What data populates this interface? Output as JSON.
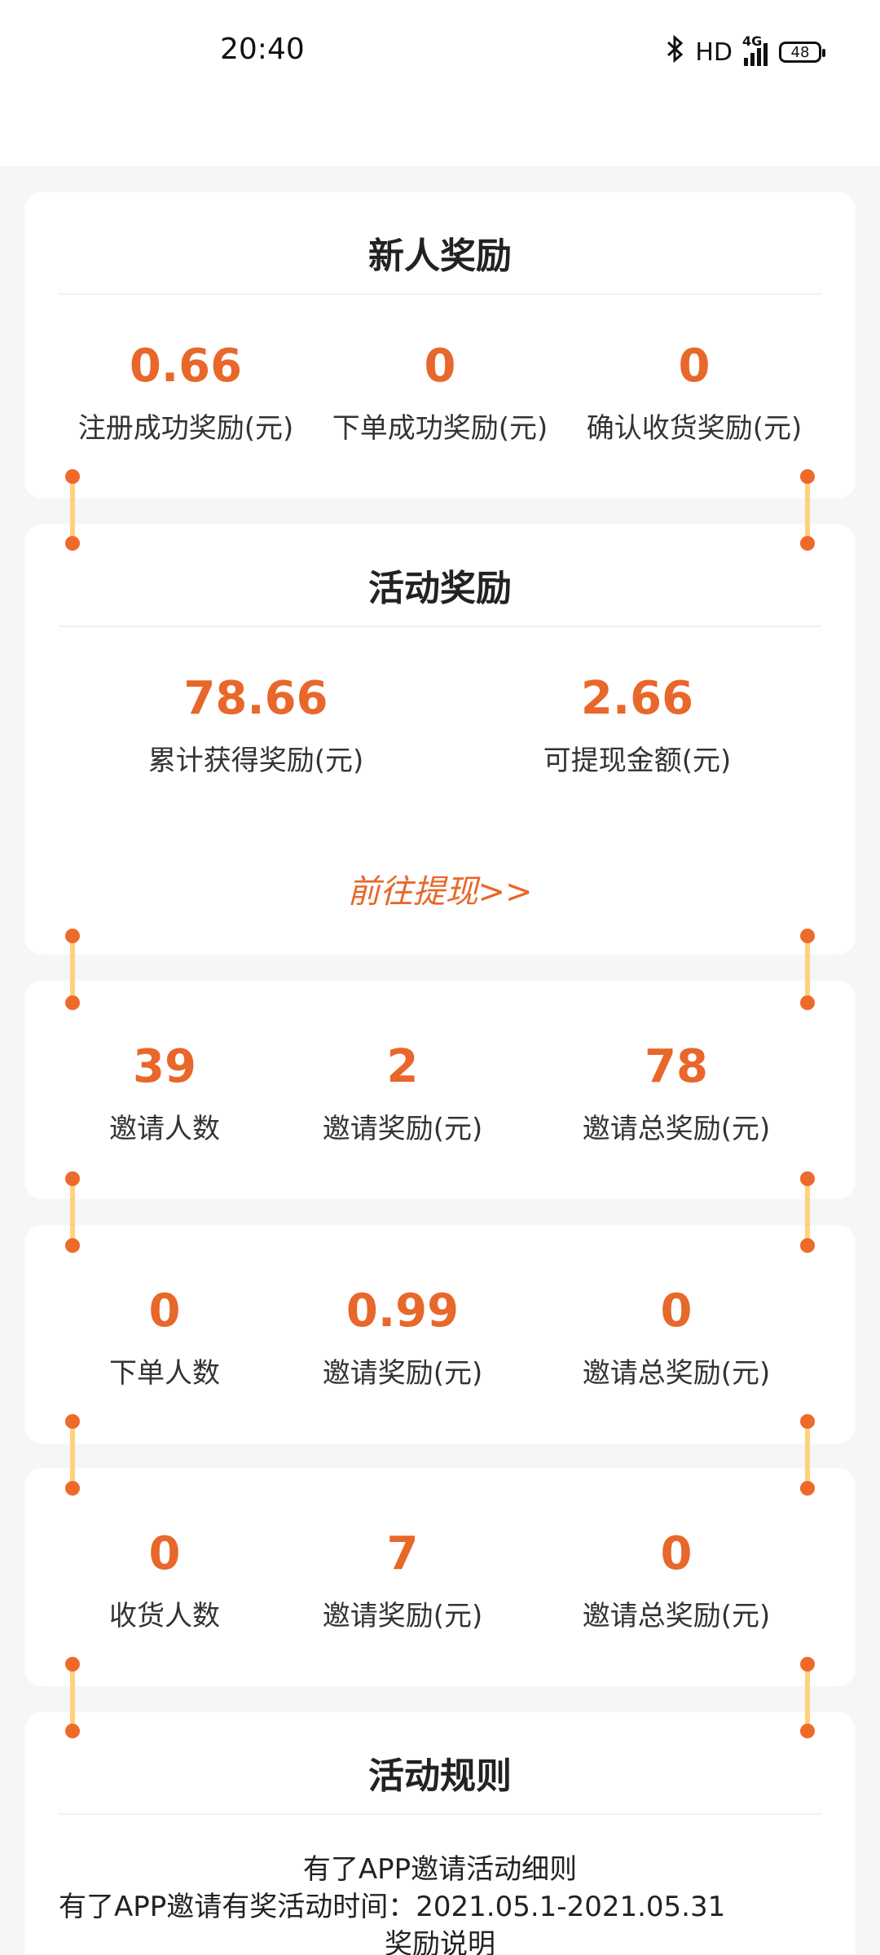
{
  "status_bar": {
    "time": "20:40",
    "network": "HD",
    "signal": "4G",
    "battery": "48"
  },
  "new_user_reward": {
    "title": "新人奖励",
    "stats": [
      {
        "value": "0.66",
        "label": "注册成功奖励(元)"
      },
      {
        "value": "0",
        "label": "下单成功奖励(元)"
      },
      {
        "value": "0",
        "label": "确认收货奖励(元)"
      }
    ]
  },
  "activity_reward": {
    "title": "活动奖励",
    "stats": [
      {
        "value": "78.66",
        "label": "累计获得奖励(元)"
      },
      {
        "value": "2.66",
        "label": "可提现金额(元)"
      }
    ],
    "withdraw_link": "前往提现>>"
  },
  "invite_stats": {
    "stats": [
      {
        "value": "39",
        "label": "邀请人数"
      },
      {
        "value": "2",
        "label": "邀请奖励(元)"
      },
      {
        "value": "78",
        "label": "邀请总奖励(元)"
      }
    ]
  },
  "order_stats": {
    "stats": [
      {
        "value": "0",
        "label": "下单人数"
      },
      {
        "value": "0.99",
        "label": "邀请奖励(元)"
      },
      {
        "value": "0",
        "label": "邀请总奖励(元)"
      }
    ]
  },
  "receipt_stats": {
    "stats": [
      {
        "value": "0",
        "label": "收货人数"
      },
      {
        "value": "7",
        "label": "邀请奖励(元)"
      },
      {
        "value": "0",
        "label": "邀请总奖励(元)"
      }
    ]
  },
  "rules": {
    "title": "活动规则",
    "lines": [
      "有了APP邀请活动细则",
      "有了APP邀请有奖活动时间：2021.05.1-2021.05.31",
      "奖励说明"
    ]
  },
  "colors": {
    "accent": "#e8672a",
    "connector_bar": "#ffd27a",
    "background": "#f6f6f6"
  }
}
